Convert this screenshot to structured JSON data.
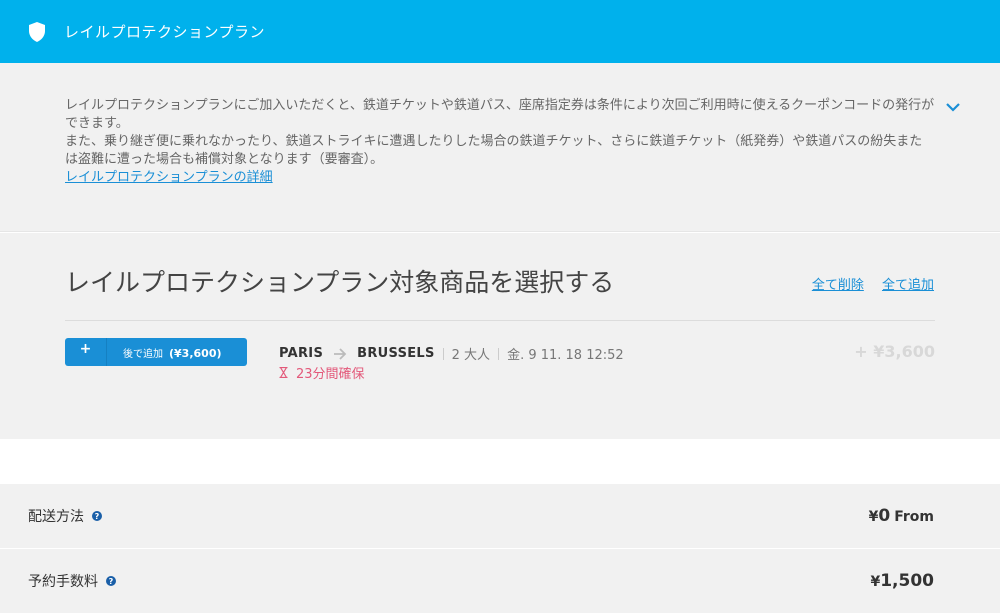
{
  "header": {
    "title": "レイルプロテクションプラン",
    "icon": "shield-icon",
    "bg_color": "#00b1ec"
  },
  "info": {
    "line1": "レイルプロテクションプランにご加入いただくと、鉄道チケットや鉄道パス、座席指定券は条件により次回ご利用時に使えるクーポンコードの発行ができます。",
    "line2": "また、乗り継ぎ便に乗れなかったり、鉄道ストライキに遭遇したりした場合の鉄道チケット、さらに鉄道チケット（紙発券）や鉄道パスの紛失または盗難に遭った場合も補償対象となります（要審査）。",
    "link": "レイルプロテクションプランの詳細"
  },
  "select": {
    "title": "レイルプロテクションプラン対象商品を選択する",
    "remove_all": "全て削除",
    "add_all": "全て追加",
    "item": {
      "add_symbol": "+",
      "add_label": "後で追加",
      "add_price": "(¥3,600)",
      "origin": "PARIS",
      "destination": "BRUSSELS",
      "passengers": "2 大人",
      "datetime": "金. 9 11. 18 12:52",
      "hold_text": "23分間確保",
      "plus_price": "+ ¥3,600"
    }
  },
  "delivery": {
    "label": "配送方法",
    "currency": "¥",
    "amount": "0",
    "suffix": "From"
  },
  "booking_fee": {
    "label": "予約手数料",
    "currency": "¥",
    "amount": "1,500"
  },
  "colors": {
    "accent": "#1a8fd6",
    "hold": "#e3597a"
  }
}
